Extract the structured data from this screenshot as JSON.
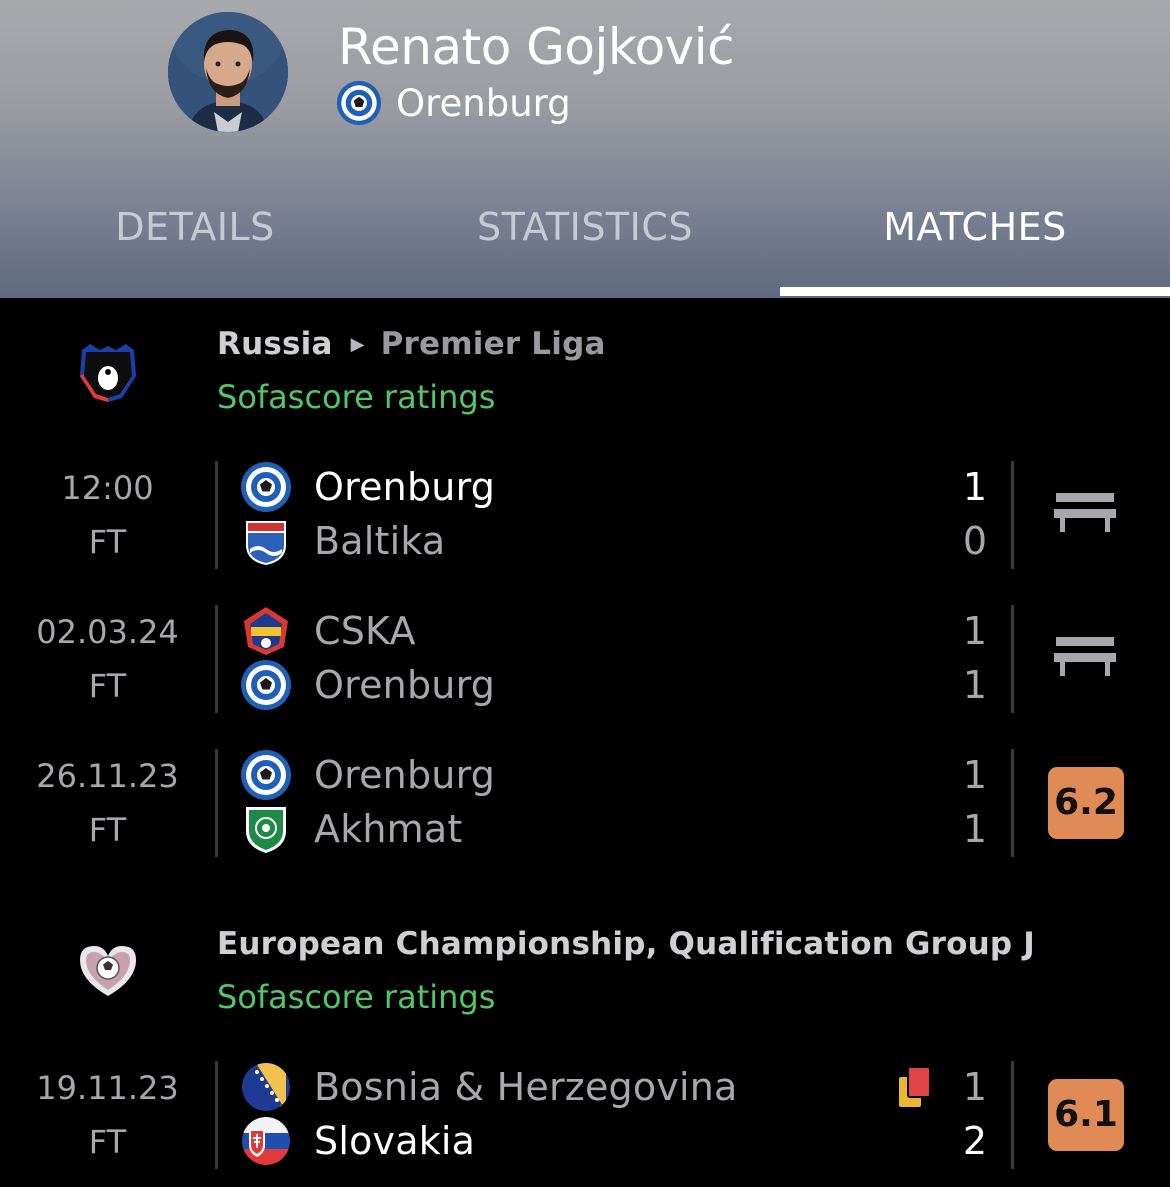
{
  "player": {
    "name": "Renato Gojković",
    "team": "Orenburg"
  },
  "tabs": [
    {
      "label": "DETAILS",
      "active": false
    },
    {
      "label": "STATISTICS",
      "active": false
    },
    {
      "label": "MATCHES",
      "active": true
    }
  ],
  "colors": {
    "accent_green": "#51c66a",
    "rating_orange": "#e08a55",
    "background": "#000000"
  },
  "sections": [
    {
      "league_country": "Russia",
      "league_name": "Premier Liga",
      "ratings_label": "Sofascore ratings",
      "icon": "russian-premier-liga-logo",
      "matches": [
        {
          "time": "12:00",
          "status": "FT",
          "home": {
            "name": "Orenburg",
            "score": "1",
            "icon": "orenburg-crest"
          },
          "away": {
            "name": "Baltika",
            "score": "0",
            "icon": "baltika-crest"
          },
          "rating": null,
          "bench": true
        },
        {
          "time": "02.03.24",
          "status": "FT",
          "home": {
            "name": "CSKA",
            "score": "1",
            "icon": "cska-crest"
          },
          "away": {
            "name": "Orenburg",
            "score": "1",
            "icon": "orenburg-crest"
          },
          "rating": null,
          "bench": true
        },
        {
          "time": "26.11.23",
          "status": "FT",
          "home": {
            "name": "Orenburg",
            "score": "1",
            "icon": "orenburg-crest"
          },
          "away": {
            "name": "Akhmat",
            "score": "1",
            "icon": "akhmat-crest"
          },
          "rating": "6.2",
          "bench": false
        }
      ]
    },
    {
      "league_title": "European Championship, Qualification Group J",
      "ratings_label": "Sofascore ratings",
      "icon": "euro-qualification-logo",
      "matches": [
        {
          "time": "19.11.23",
          "status": "FT",
          "home": {
            "name": "Bosnia & Herzegovina",
            "score": "1",
            "icon": "bosnia-flag"
          },
          "away": {
            "name": "Slovakia",
            "score": "2",
            "icon": "slovakia-flag"
          },
          "rating": "6.1",
          "bench": false,
          "cards": "yellow-red-card-icon"
        }
      ]
    }
  ]
}
